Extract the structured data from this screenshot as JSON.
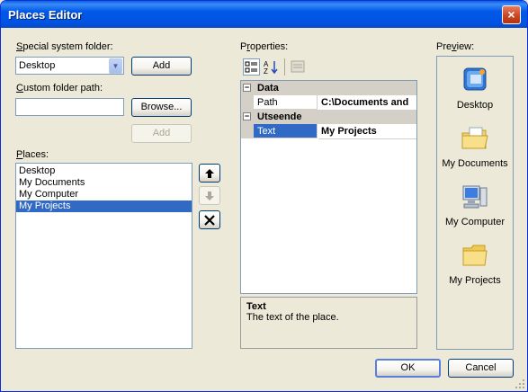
{
  "window": {
    "title": "Places Editor"
  },
  "special_folder": {
    "label_prefix": "",
    "label_ul": "S",
    "label_rest": "pecial system folder:",
    "selected": "Desktop",
    "add_label": "Add"
  },
  "custom_path": {
    "label_ul": "C",
    "label_rest": "ustom folder path:",
    "value": "",
    "browse_label": "Browse...",
    "add_label": "Add"
  },
  "places": {
    "label_ul": "P",
    "label_rest": "laces:",
    "items": [
      "Desktop",
      "My Documents",
      "My Computer",
      "My Projects"
    ],
    "selected_index": 3
  },
  "properties": {
    "label_prefix": "P",
    "label_ul": "r",
    "label_rest": "operties:",
    "categories": [
      {
        "name": "Data",
        "toggle": "⊟",
        "props": [
          {
            "name": "Path",
            "value": "C:\\Documents and"
          }
        ]
      },
      {
        "name": "Utseende",
        "toggle": "⊟",
        "props": [
          {
            "name": "Text",
            "value": "My Projects"
          }
        ]
      }
    ],
    "description_title": "Text",
    "description_text": "The text of the place."
  },
  "preview": {
    "label_prefix": "Pre",
    "label_ul": "v",
    "label_rest": "iew:",
    "items": [
      "Desktop",
      "My Documents",
      "My Computer",
      "My Projects"
    ]
  },
  "footer": {
    "ok_label": "OK",
    "cancel_label": "Cancel"
  },
  "icons": {
    "close": "×",
    "dropdown": "▼",
    "move_up": "🡅",
    "move_down": "🡇",
    "delete": "✕"
  },
  "colors": {
    "title_bar": "#0054e3",
    "selection": "#316ac5",
    "dialog_bg": "#ece9d8"
  }
}
